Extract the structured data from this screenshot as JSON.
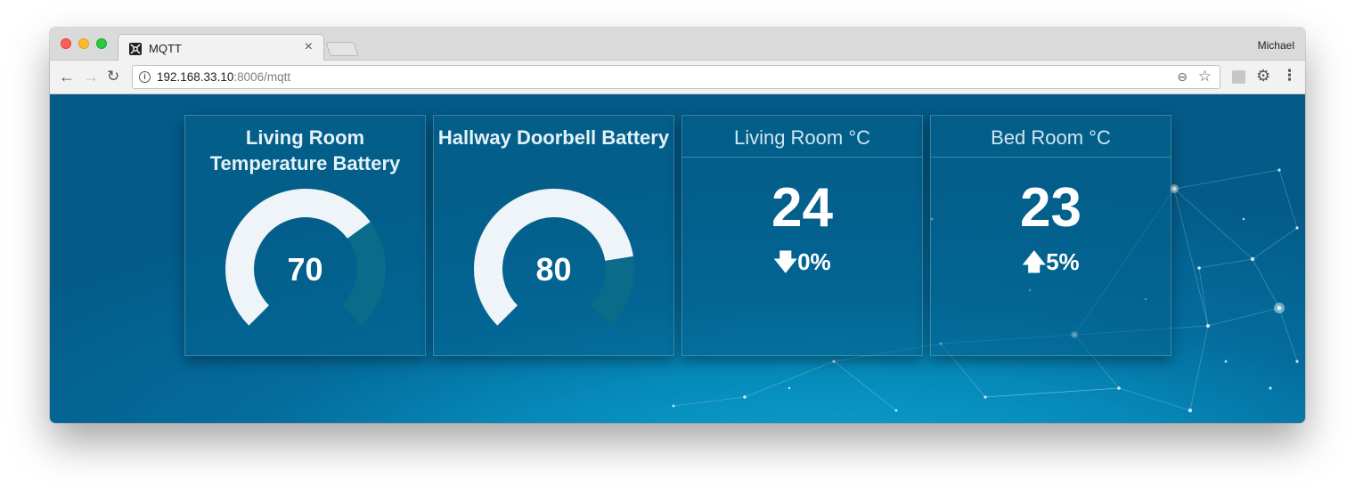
{
  "browser": {
    "tab_title": "MQTT",
    "tab_close": "×",
    "profile_name": "Michael",
    "url_host": "192.168.33.10",
    "url_rest": ":8006/mqtt"
  },
  "icons": {
    "back": "←",
    "forward": "→",
    "reload": "↻",
    "info": "i",
    "zoom": "⊖",
    "star": "☆",
    "gear": "⚙",
    "menu": "⋮"
  },
  "colors": {
    "gauge_fill": "#eef4f7",
    "gauge_track": "#0a6c88",
    "background": "#0689b9"
  },
  "gauges": [
    {
      "title": "Living Room Temperature Battery",
      "value": "70",
      "level": 70
    },
    {
      "title": "Hallway Doorbell Battery",
      "value": "80",
      "level": 80
    }
  ],
  "sensors": [
    {
      "title": "Living Room °C",
      "value": "24",
      "arrow": "🡇",
      "change": "0%",
      "direction": "down"
    },
    {
      "title": "Bed Room °C",
      "value": "23",
      "arrow": "🡅",
      "change": "5%",
      "direction": "up"
    }
  ]
}
